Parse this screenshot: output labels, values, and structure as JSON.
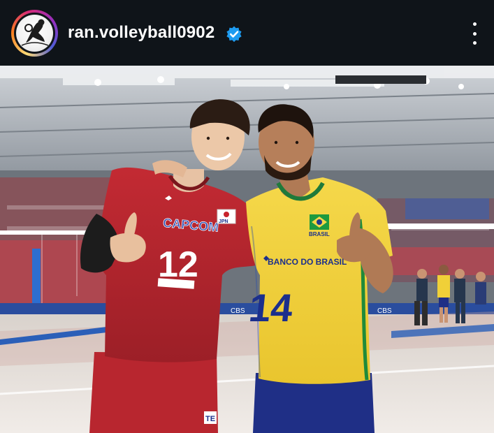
{
  "header": {
    "username": "ran.volleyball0902",
    "verified": true,
    "avatar_icon": "volleyball-player-avatar",
    "more_icon": "more-vertical-icon"
  },
  "photo": {
    "left_player": {
      "jersey_sponsor": "CAPCOM",
      "jersey_number": "12",
      "country_patch": "JPN",
      "shorts_mark": "TE",
      "jersey_color": "#b0222a"
    },
    "right_player": {
      "jersey_sponsor": "BANCO DO BRASIL",
      "jersey_number": "14",
      "country_patch": "BRASIL",
      "jersey_color": "#f2d43a",
      "shorts_color": "#1f2f86"
    },
    "arena_signage": "CBS"
  },
  "colors": {
    "background": "#0f1419",
    "verified_blue": "#1d9bf0",
    "court_floor": "#e9e2dc"
  }
}
